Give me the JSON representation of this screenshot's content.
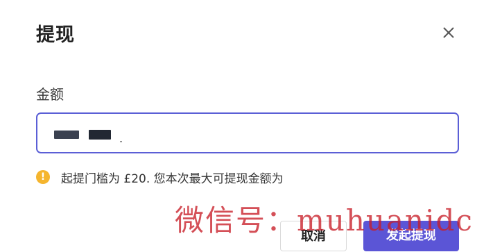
{
  "dialog": {
    "title": "提现",
    "amount_label": "金额",
    "amount_value": ".",
    "hint": "起提门槛为 £20. 您本次最大可提现金额为"
  },
  "icons": {
    "close": "close-icon",
    "warning": "exclamation-circle-icon"
  },
  "actions": {
    "cancel_label": "取消",
    "submit_label": "发起提现"
  },
  "watermark": {
    "text": "微信号：muhuanidc"
  },
  "colors": {
    "accent": "#5b55d6",
    "warning": "#f5b52e",
    "watermark": "#c81e28"
  }
}
